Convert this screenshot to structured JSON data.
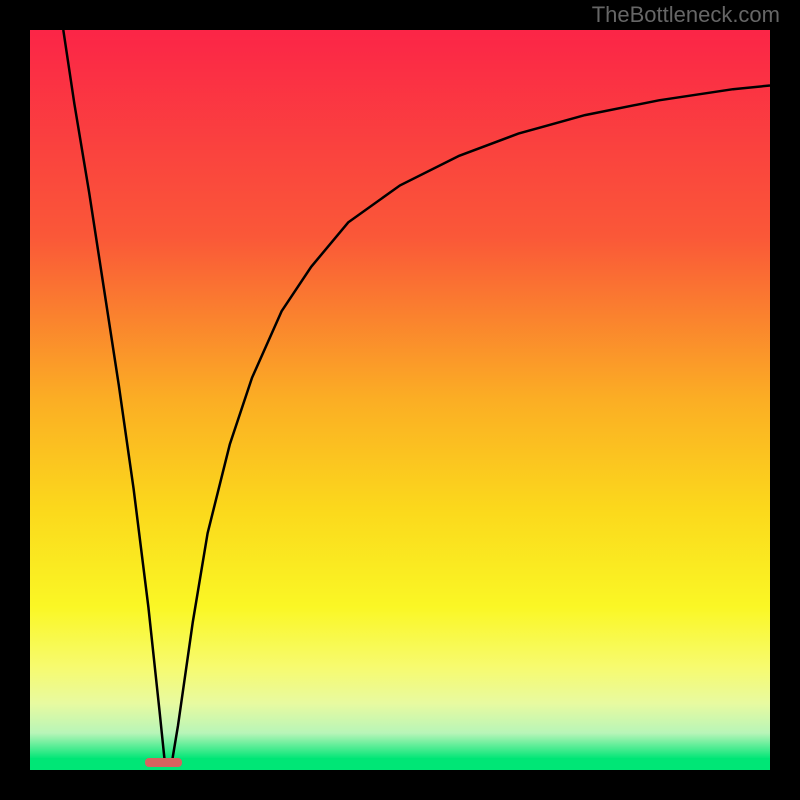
{
  "watermark": "TheBottleneck.com",
  "chart_data": {
    "type": "line",
    "title": "",
    "xlabel": "",
    "ylabel": "",
    "x_range": [
      0,
      100
    ],
    "y_range": [
      0,
      100
    ],
    "marker_x": 18,
    "marker_width": 5,
    "curve_points": [
      {
        "x": 4.5,
        "y": 100
      },
      {
        "x": 6,
        "y": 90
      },
      {
        "x": 8,
        "y": 78
      },
      {
        "x": 10,
        "y": 65
      },
      {
        "x": 12,
        "y": 52
      },
      {
        "x": 14,
        "y": 38
      },
      {
        "x": 16,
        "y": 22
      },
      {
        "x": 17.5,
        "y": 8
      },
      {
        "x": 18.2,
        "y": 1.2
      },
      {
        "x": 19.2,
        "y": 1.2
      },
      {
        "x": 20,
        "y": 6
      },
      {
        "x": 22,
        "y": 20
      },
      {
        "x": 24,
        "y": 32
      },
      {
        "x": 27,
        "y": 44
      },
      {
        "x": 30,
        "y": 53
      },
      {
        "x": 34,
        "y": 62
      },
      {
        "x": 38,
        "y": 68
      },
      {
        "x": 43,
        "y": 74
      },
      {
        "x": 50,
        "y": 79
      },
      {
        "x": 58,
        "y": 83
      },
      {
        "x": 66,
        "y": 86
      },
      {
        "x": 75,
        "y": 88.5
      },
      {
        "x": 85,
        "y": 90.5
      },
      {
        "x": 95,
        "y": 92
      },
      {
        "x": 100,
        "y": 92.5
      }
    ],
    "gradient_stops": [
      {
        "pos": 0,
        "color": "#fb2547"
      },
      {
        "pos": 28,
        "color": "#fa5838"
      },
      {
        "pos": 50,
        "color": "#fbae24"
      },
      {
        "pos": 65,
        "color": "#fbd91c"
      },
      {
        "pos": 78,
        "color": "#faf725"
      },
      {
        "pos": 86,
        "color": "#f7fb6e"
      },
      {
        "pos": 91,
        "color": "#e8faa0"
      },
      {
        "pos": 95,
        "color": "#b8f5b8"
      },
      {
        "pos": 98.5,
        "color": "#00e676"
      }
    ]
  }
}
